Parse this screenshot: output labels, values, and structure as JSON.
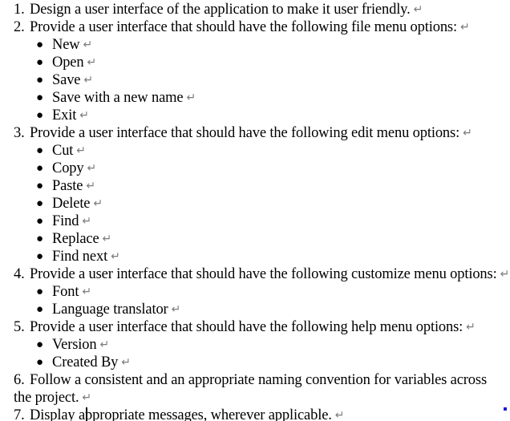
{
  "document": {
    "return_mark": "↵",
    "bullet_glyph": "●",
    "caret_visible": true,
    "blue_anchor_color": "#1a1ad0",
    "lines": [
      {
        "number": "1.",
        "text": "Design a user interface of the application to make it user friendly."
      },
      {
        "number": "2.",
        "text": "Provide a user interface that should have the following file menu options:"
      },
      {
        "bullet": "New"
      },
      {
        "bullet": "Open"
      },
      {
        "bullet": "Save"
      },
      {
        "bullet": "Save with a new name"
      },
      {
        "bullet": "Exit"
      },
      {
        "number": "3.",
        "text": "Provide a user interface that should have the following edit menu options:"
      },
      {
        "bullet": "Cut"
      },
      {
        "bullet": "Copy"
      },
      {
        "bullet": "Paste"
      },
      {
        "bullet": "Delete"
      },
      {
        "bullet": "Find"
      },
      {
        "bullet": "Replace"
      },
      {
        "bullet": "Find next"
      },
      {
        "number": "4.",
        "text": "Provide a user interface that should have the following customize menu options:"
      },
      {
        "bullet": "Font"
      },
      {
        "bullet": "Language translator"
      },
      {
        "number": "5.",
        "text": "Provide a user interface that should have the following help menu options:"
      },
      {
        "bullet": "Version"
      },
      {
        "bullet": "Created By"
      },
      {
        "number": "6.",
        "text": "Follow a consistent and an appropriate naming convention for variables across"
      },
      {
        "continuation": "the project."
      },
      {
        "number": "7.",
        "text": "Display appropriate messages, wherever applicable."
      }
    ]
  }
}
